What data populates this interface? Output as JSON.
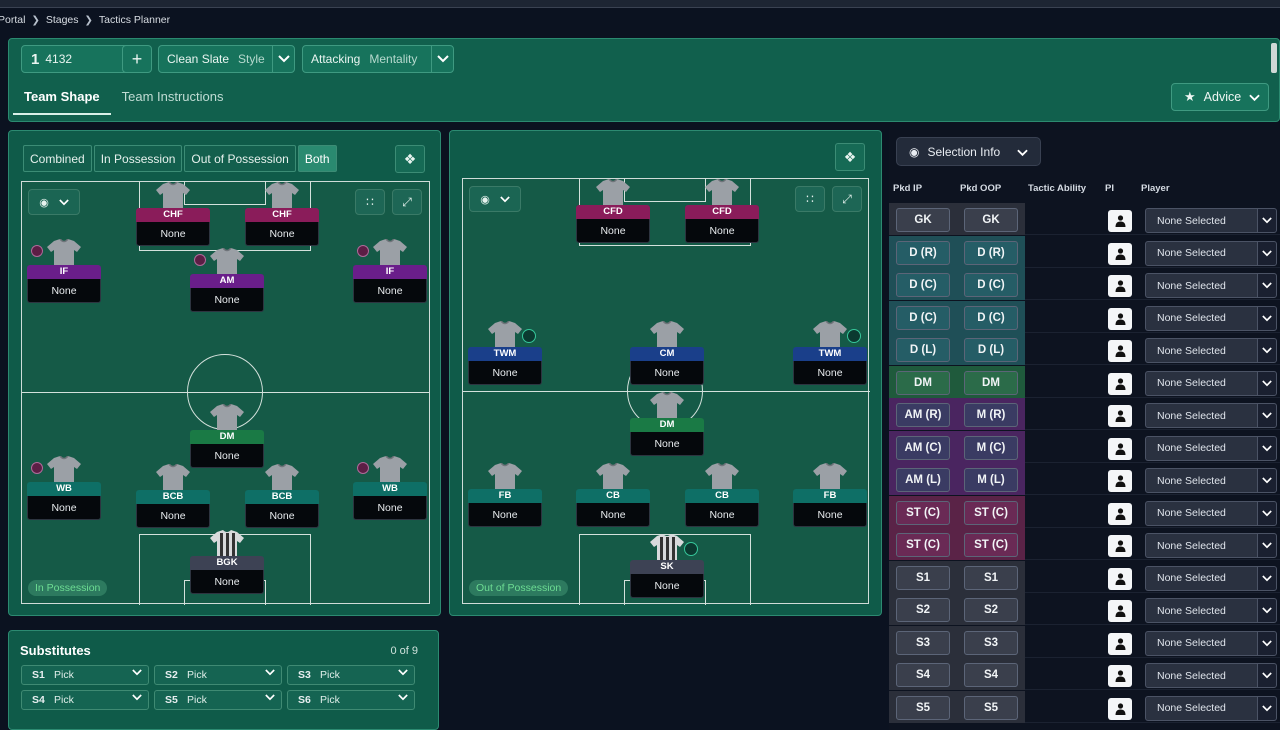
{
  "breadcrumb": {
    "items": [
      "Portal",
      "Stages",
      "Tactics Planner"
    ]
  },
  "tactic": {
    "slot_number": "1",
    "formation": "4132",
    "add_label": "+",
    "style_name": "Clean Slate",
    "style_label": "Style",
    "mentality_name": "Attacking",
    "mentality_label": "Mentality"
  },
  "tabs": [
    {
      "label": "Team Shape",
      "active": true
    },
    {
      "label": "Team Instructions",
      "active": false
    }
  ],
  "advice": {
    "label": "Advice",
    "icon": "star-icon"
  },
  "phase_buttons": [
    {
      "label": "Combined",
      "active": false
    },
    {
      "label": "In Possession",
      "active": false
    },
    {
      "label": "Out of Possession",
      "active": false
    },
    {
      "label": "Both",
      "active": true
    }
  ],
  "in_possession": {
    "label": "In Possession",
    "players": [
      {
        "role": "CHF",
        "name": "None",
        "cat": "fw"
      },
      {
        "role": "CHF",
        "name": "None",
        "cat": "fw"
      },
      {
        "role": "IF",
        "name": "None",
        "cat": "am"
      },
      {
        "role": "AM",
        "name": "None",
        "cat": "am"
      },
      {
        "role": "IF",
        "name": "None",
        "cat": "am"
      },
      {
        "role": "DM",
        "name": "None",
        "cat": "dm"
      },
      {
        "role": "WB",
        "name": "None",
        "cat": "df"
      },
      {
        "role": "BCB",
        "name": "None",
        "cat": "df"
      },
      {
        "role": "BCB",
        "name": "None",
        "cat": "df"
      },
      {
        "role": "WB",
        "name": "None",
        "cat": "df"
      },
      {
        "role": "BGK",
        "name": "None",
        "cat": "gk"
      }
    ]
  },
  "out_of_possession": {
    "label": "Out of Possession",
    "players": [
      {
        "role": "CFD",
        "name": "None",
        "cat": "fw"
      },
      {
        "role": "CFD",
        "name": "None",
        "cat": "fw"
      },
      {
        "role": "TWM",
        "name": "None",
        "cat": "mid"
      },
      {
        "role": "CM",
        "name": "None",
        "cat": "mid"
      },
      {
        "role": "TWM",
        "name": "None",
        "cat": "mid"
      },
      {
        "role": "DM",
        "name": "None",
        "cat": "dm"
      },
      {
        "role": "FB",
        "name": "None",
        "cat": "df"
      },
      {
        "role": "CB",
        "name": "None",
        "cat": "df"
      },
      {
        "role": "CB",
        "name": "None",
        "cat": "df"
      },
      {
        "role": "FB",
        "name": "None",
        "cat": "df"
      },
      {
        "role": "SK",
        "name": "None",
        "cat": "gk"
      }
    ]
  },
  "substitutes": {
    "title": "Substitutes",
    "count": "0 of 9",
    "slots": [
      {
        "label": "S1",
        "value": "Pick"
      },
      {
        "label": "S2",
        "value": "Pick"
      },
      {
        "label": "S3",
        "value": "Pick"
      },
      {
        "label": "S4",
        "value": "Pick"
      },
      {
        "label": "S5",
        "value": "Pick"
      },
      {
        "label": "S6",
        "value": "Pick"
      }
    ]
  },
  "selection": {
    "button_label": "Selection Info",
    "columns": [
      "Pkd IP",
      "Pkd OOP",
      "Tactic Ability",
      "PI",
      "Player"
    ],
    "rows": [
      {
        "ip": "GK",
        "oop": "GK",
        "player": "None Selected",
        "group": "gk"
      },
      {
        "ip": "D (R)",
        "oop": "D (R)",
        "player": "None Selected",
        "group": "df"
      },
      {
        "ip": "D (C)",
        "oop": "D (C)",
        "player": "None Selected",
        "group": "df"
      },
      {
        "ip": "D (C)",
        "oop": "D (C)",
        "player": "None Selected",
        "group": "df"
      },
      {
        "ip": "D (L)",
        "oop": "D (L)",
        "player": "None Selected",
        "group": "df"
      },
      {
        "ip": "DM",
        "oop": "DM",
        "player": "None Selected",
        "group": "dm"
      },
      {
        "ip": "AM (R)",
        "oop": "M (R)",
        "player": "None Selected",
        "group": "am"
      },
      {
        "ip": "AM (C)",
        "oop": "M (C)",
        "player": "None Selected",
        "group": "am"
      },
      {
        "ip": "AM (L)",
        "oop": "M (L)",
        "player": "None Selected",
        "group": "am"
      },
      {
        "ip": "ST (C)",
        "oop": "ST (C)",
        "player": "None Selected",
        "group": "fw"
      },
      {
        "ip": "ST (C)",
        "oop": "ST (C)",
        "player": "None Selected",
        "group": "fw"
      },
      {
        "ip": "S1",
        "oop": "S1",
        "player": "None Selected",
        "group": "sub"
      },
      {
        "ip": "S2",
        "oop": "S2",
        "player": "None Selected",
        "group": "sub"
      },
      {
        "ip": "S3",
        "oop": "S3",
        "player": "None Selected",
        "group": "sub"
      },
      {
        "ip": "S4",
        "oop": "S4",
        "player": "None Selected",
        "group": "sub"
      },
      {
        "ip": "S5",
        "oop": "S5",
        "player": "None Selected",
        "group": "sub"
      }
    ]
  },
  "colors": {
    "accent_green": "#11604d",
    "forward": "#8a1c5a",
    "attacking_mid": "#6a1e8a",
    "defensive_mid": "#1a7a45",
    "defender": "#0e6f66",
    "goalkeeper": "#3d4254",
    "midfielder": "#1a3f8a"
  }
}
